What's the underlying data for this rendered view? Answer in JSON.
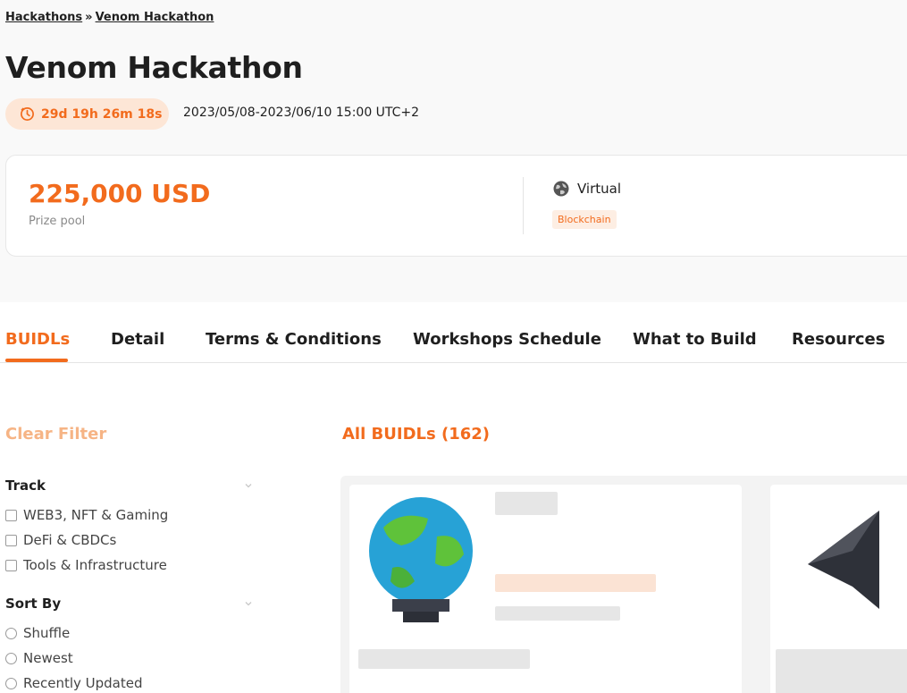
{
  "breadcrumb": {
    "parent": "Hackathons",
    "separator": "»",
    "current": "Venom Hackathon"
  },
  "hackathon": {
    "title": "Venom Hackathon",
    "countdown": "29d 19h 26m 18s",
    "date_range": "2023/05/08-2023/06/10 15:00 UTC+2",
    "prize_amount": "225,000 USD",
    "prize_label": "Prize pool",
    "location": "Virtual",
    "tag": "Blockchain"
  },
  "tabs": [
    {
      "label": "BUIDLs",
      "active": true
    },
    {
      "label": "Detail"
    },
    {
      "label": "Terms & Conditions"
    },
    {
      "label": "Workshops Schedule"
    },
    {
      "label": "What to Build"
    },
    {
      "label": "Resources"
    }
  ],
  "filters": {
    "clear_label": "Clear Filter",
    "track": {
      "title": "Track",
      "options": [
        "WEB3, NFT & Gaming",
        "DeFi & CBDCs",
        "Tools & Infrastructure"
      ]
    },
    "sort": {
      "title": "Sort By",
      "options": [
        "Shuffle",
        "Newest",
        "Recently Updated"
      ]
    }
  },
  "results": {
    "heading": "All BUIDLs (162)"
  },
  "colors": {
    "accent": "#f26b1d",
    "accent_light": "#fde6d6",
    "muted_accent": "#f6b485"
  },
  "icons": [
    "timer-icon",
    "globe-icon",
    "chevron-down-icon"
  ]
}
